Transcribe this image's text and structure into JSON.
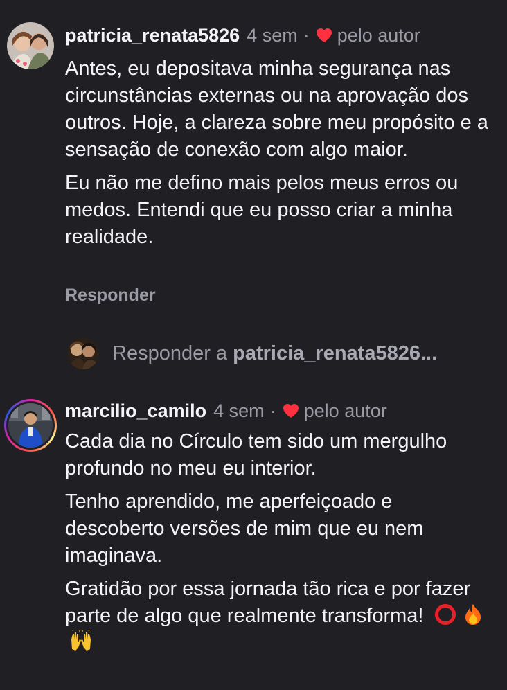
{
  "comments": [
    {
      "username": "patricia_renata5826",
      "time": "4 sem",
      "separator": "·",
      "liked_label": "pelo autor",
      "paragraphs": [
        "Antes, eu depositava minha segurança nas circunstâncias externas ou na aprovação dos outros. Hoje, a clareza sobre meu propósito e a sensação de conexão com algo maior.",
        "Eu não me defino mais pelos meus erros ou medos. Entendi que eu posso criar a minha realidade."
      ],
      "reply_label": "Responder"
    },
    {
      "username": "marcilio_camilo",
      "time": "4 sem",
      "separator": "·",
      "liked_label": "pelo autor",
      "paragraphs": [
        "Cada dia no Círculo tem sido um mergulho profundo no meu eu interior.",
        "Tenho aprendido, me aperfeiçoado e descoberto versões de mim que eu nem imaginava.",
        "Gratidão por essa jornada tão rica e por fazer parte de algo que realmente transforma!"
      ],
      "emojis": [
        "circle-icon",
        "fire-icon",
        "raised-hands-icon"
      ]
    }
  ],
  "reply_input": {
    "prefix": "Responder a",
    "target": "patricia_renata5826..."
  },
  "colors": {
    "background": "#1f1f24",
    "text": "#f4f4f6",
    "muted": "#9b9ba5",
    "heart": "#ff3040"
  }
}
